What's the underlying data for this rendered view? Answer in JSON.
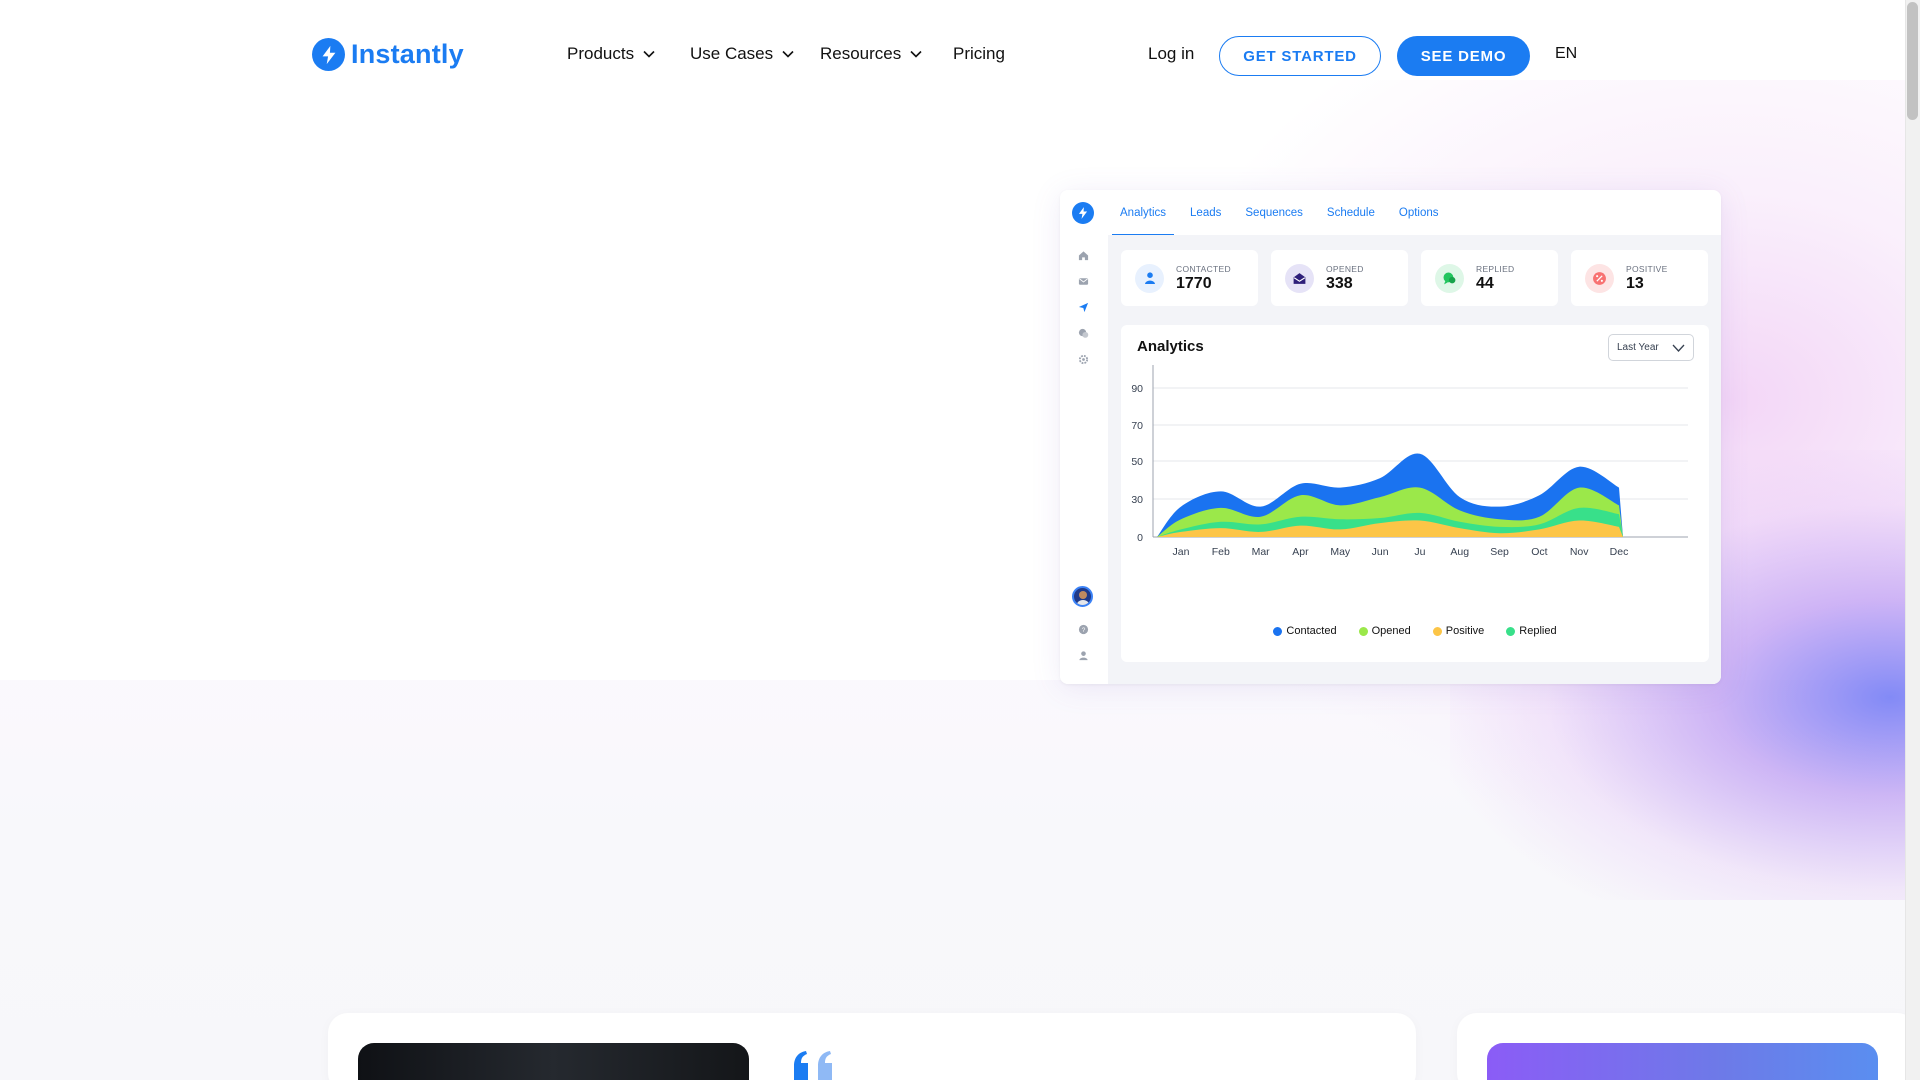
{
  "brand": {
    "name": "Instantly",
    "color": "#1b7cf2"
  },
  "nav": {
    "items": [
      {
        "label": "Products",
        "has_dropdown": true
      },
      {
        "label": "Use Cases",
        "has_dropdown": true
      },
      {
        "label": "Resources",
        "has_dropdown": true
      },
      {
        "label": "Pricing",
        "has_dropdown": false
      }
    ],
    "login": "Log in",
    "get_started": "GET STARTED",
    "see_demo": "SEE DEMO",
    "language": "EN"
  },
  "dashboard": {
    "tabs": [
      "Analytics",
      "Leads",
      "Sequences",
      "Schedule",
      "Options"
    ],
    "active_tab": "Analytics",
    "sidebar_icons": [
      "home-icon",
      "mail-icon",
      "send-icon",
      "chat-icon",
      "settings-icon"
    ],
    "sidebar_bottom_icons": [
      "user-avatar",
      "help-icon",
      "account-icon"
    ],
    "stats": [
      {
        "label": "CONTACTED",
        "value": "1770",
        "icon": "user-icon",
        "color": "#1b7cf2",
        "bg": "#e8f1fe"
      },
      {
        "label": "OPENED",
        "value": "338",
        "icon": "envelope-open-icon",
        "color": "#2e1f7a",
        "bg": "#e6e3f7"
      },
      {
        "label": "REPLIED",
        "value": "44",
        "icon": "chat-bubble-icon",
        "color": "#22c55e",
        "bg": "#def7e7"
      },
      {
        "label": "POSITIVE",
        "value": "13",
        "icon": "percent-icon",
        "color": "#ef4444",
        "bg": "#fde4e4"
      }
    ],
    "chart_title": "Analytics",
    "period": "Last Year"
  },
  "chart_data": {
    "type": "area",
    "title": "Analytics",
    "categories": [
      "Jan",
      "Feb",
      "Mar",
      "Apr",
      "May",
      "Jun",
      "Ju",
      "Aug",
      "Sep",
      "Oct",
      "Nov",
      "Dec"
    ],
    "yticks": [
      0,
      30,
      50,
      70,
      90
    ],
    "grid": true,
    "legend_position": "bottom",
    "series": [
      {
        "name": "Contacted",
        "color": "#1a73f0",
        "values": [
          24,
          34,
          24,
          38,
          36,
          41,
          54,
          31,
          24,
          32,
          47,
          36
        ]
      },
      {
        "name": "Opened",
        "color": "#9be84a",
        "values": [
          14,
          23,
          16,
          32,
          25,
          31,
          36,
          21,
          14,
          16,
          36,
          25
        ]
      },
      {
        "name": "Replied",
        "color": "#38e08a",
        "values": [
          6,
          12,
          10,
          16,
          14,
          15,
          19,
          12,
          8,
          10,
          23,
          18
        ]
      },
      {
        "name": "Positive",
        "color": "#fcc547",
        "values": [
          4,
          7,
          4,
          9,
          6,
          11,
          13,
          7,
          3,
          6,
          13,
          8
        ]
      }
    ],
    "legend_order": [
      "Contacted",
      "Opened",
      "Positive",
      "Replied"
    ]
  }
}
